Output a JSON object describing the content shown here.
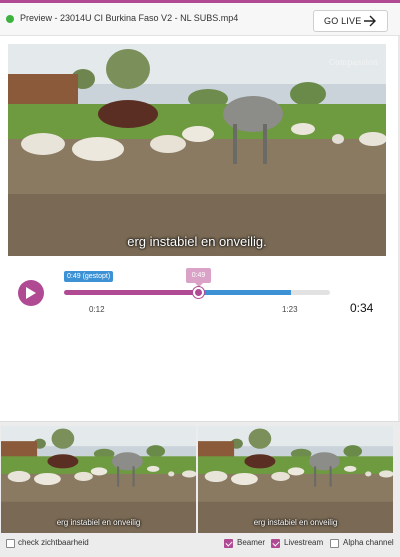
{
  "header": {
    "title": "Preview - 23014U CI Burkina Faso V2 - NL SUBS.mp4",
    "go_live_label": "GO LIVE",
    "status_color": "#3db33d",
    "accent_color": "#b04a93"
  },
  "preview": {
    "subtitle": "erg instabiel en onveilig.",
    "watermark": "Compassion"
  },
  "player": {
    "start_tag": "0:49 (gestopt)",
    "current_tag": "0:49",
    "in_time": "0:12",
    "out_time": "1:23",
    "duration": "0:34",
    "played_color": "#b04a93",
    "range_color": "#3d92d6"
  },
  "monitors": {
    "left_subtitle": "erg instabiel en onveilig",
    "right_subtitle": "erg instabiel en onveilig"
  },
  "options": {
    "check_visibility": {
      "label": "check zichtbaarheid",
      "checked": false
    },
    "beamer": {
      "label": "Beamer",
      "checked": true
    },
    "livestream": {
      "label": "Livestream",
      "checked": true
    },
    "alpha_channel": {
      "label": "Alpha channel",
      "checked": false
    }
  }
}
